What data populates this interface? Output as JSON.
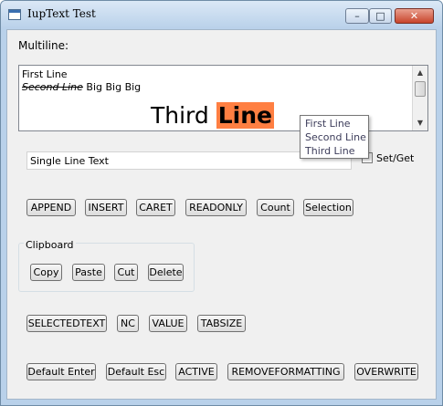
{
  "window": {
    "title": "IupText Test",
    "min_glyph": "–",
    "max_glyph": "□",
    "close_glyph": "✕"
  },
  "multiline": {
    "label": "Multiline:",
    "line1": "First Line",
    "line2_strike": "Second Line",
    "line2_rest": " Big Big Big",
    "line3_normal": "Third ",
    "line3_highlight": "Line"
  },
  "dropdown": {
    "options": [
      "First Line",
      "Second Line",
      "Third Line"
    ]
  },
  "single_line": {
    "value": "Single Line Text"
  },
  "setget": {
    "label": "Set/Get",
    "checked": false
  },
  "buttons_row1": [
    "APPEND",
    "INSERT",
    "CARET",
    "READONLY",
    "Count",
    "Selection"
  ],
  "clipboard": {
    "title": "Clipboard",
    "buttons": [
      "Copy",
      "Paste",
      "Cut",
      "Delete"
    ]
  },
  "buttons_row3": [
    "SELECTEDTEXT",
    "NC",
    "VALUE",
    "TABSIZE"
  ],
  "buttons_row4": [
    "Default Enter",
    "Default Esc",
    "ACTIVE",
    "REMOVEFORMATTING",
    "OVERWRITE"
  ],
  "scroll": {
    "up_glyph": "▲",
    "down_glyph": "▼"
  },
  "colors": {
    "highlight": "#ff7f42"
  }
}
